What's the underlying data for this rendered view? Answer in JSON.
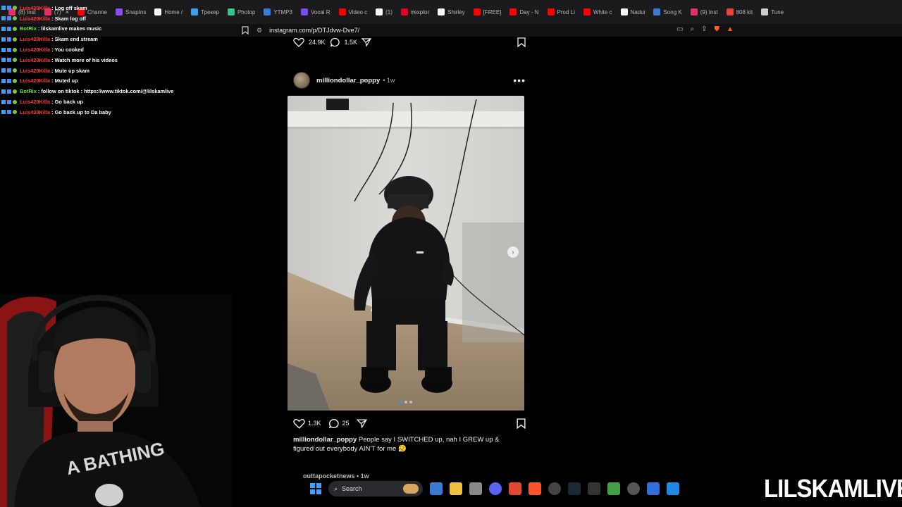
{
  "browser": {
    "tabs": [
      {
        "label": "(8) Inst",
        "color": "#e1306c"
      },
      {
        "label": "(7)",
        "color": "#e1306c"
      },
      {
        "label": "Channe",
        "color": "#ff0000"
      },
      {
        "label": "SnapIns",
        "color": "#8a4df0"
      },
      {
        "label": "Home /",
        "color": "#ffffff"
      },
      {
        "label": "Трекер",
        "color": "#3fa0f0"
      },
      {
        "label": "Photop",
        "color": "#31c48d"
      },
      {
        "label": "YTMP3",
        "color": "#3a7bd5"
      },
      {
        "label": "Vocal R",
        "color": "#7a4df0"
      },
      {
        "label": "Video c",
        "color": "#ff0000"
      },
      {
        "label": "(1)",
        "color": "#ffffff"
      },
      {
        "label": "#explor",
        "color": "#e60023"
      },
      {
        "label": "Shirley",
        "color": "#ffffff"
      },
      {
        "label": "[FREE]",
        "color": "#ff0000"
      },
      {
        "label": "Day - N",
        "color": "#ff0000"
      },
      {
        "label": "Prod Li",
        "color": "#ff0000"
      },
      {
        "label": "White c",
        "color": "#ff0000"
      },
      {
        "label": "Nadui",
        "color": "#ffffff"
      },
      {
        "label": "Song K",
        "color": "#3a7bd5"
      },
      {
        "label": "(9) Inst",
        "color": "#e1306c"
      },
      {
        "label": "808 kit",
        "color": "#ea4335"
      },
      {
        "label": "Tune",
        "color": "#cccccc"
      }
    ],
    "url": "instagram.com/p/DTJdvw-Dve7/"
  },
  "chat": [
    {
      "user": "Luis420Killa",
      "msg": ": Log off skam",
      "color": "#ff3b3b"
    },
    {
      "user": "Luis420Killa",
      "msg": ": Skam log off",
      "color": "#ff3b3b"
    },
    {
      "user": "BotRix",
      "msg": ": lilskamlive makes music",
      "color": "#7ddc3a"
    },
    {
      "user": "Luis420Killa",
      "msg": ": Skam end stream",
      "color": "#ff3b3b"
    },
    {
      "user": "Luis420Killa",
      "msg": ": You cooked",
      "color": "#ff3b3b"
    },
    {
      "user": "Luis420Killa",
      "msg": ": Watch more of his videos",
      "color": "#ff3b3b"
    },
    {
      "user": "Luis420Killa",
      "msg": ": Mute up skam",
      "color": "#ff3b3b"
    },
    {
      "user": "Luis420Killa",
      "msg": ": Muted up",
      "color": "#ff3b3b"
    },
    {
      "user": "BotRix",
      "msg": ": follow on tiktok : https://www.tiktok.com/@lilskamlive",
      "color": "#7ddc3a"
    },
    {
      "user": "Luis420Killa",
      "msg": ": Go back up",
      "color": "#ff3b3b"
    },
    {
      "user": "Luis420Killa",
      "msg": ": Go back up to Da baby",
      "color": "#ff3b3b"
    }
  ],
  "prev_post": {
    "likes": "24.9K",
    "comments": "1.5K"
  },
  "post": {
    "username": "milliondollar_poppy",
    "time": "• 1w",
    "likes": "1.3K",
    "comments": "25",
    "caption_user": "milliondollar_poppy",
    "caption_text": " People say I SWITCHED up, nah I GREW up & figured out everybody AIN'T for me 😮‍💨"
  },
  "next_post": {
    "username": "outtapocketnews • 1w"
  },
  "taskbar": {
    "search_label": "Search"
  },
  "brand": "LILSKAMLIVE"
}
